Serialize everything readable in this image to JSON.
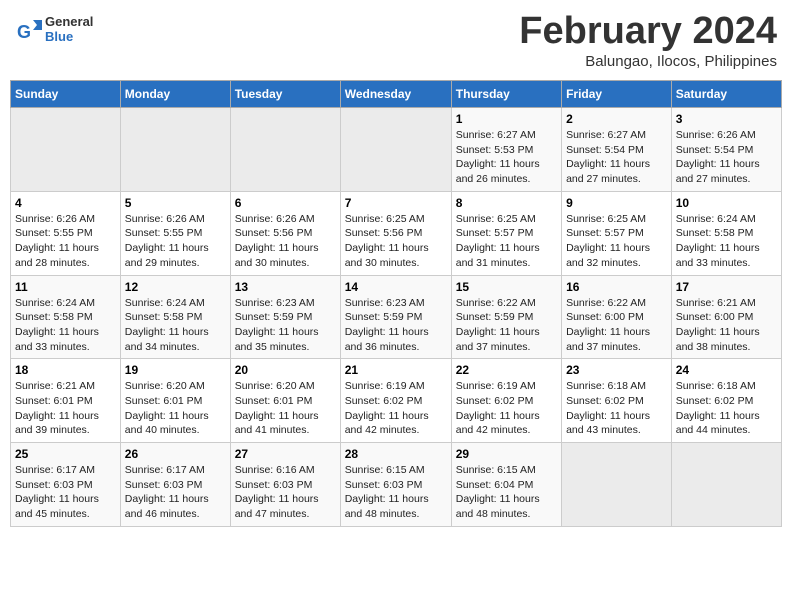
{
  "header": {
    "logo_line1": "General",
    "logo_line2": "Blue",
    "title": "February 2024",
    "subtitle": "Balungao, Ilocos, Philippines"
  },
  "days_of_week": [
    "Sunday",
    "Monday",
    "Tuesday",
    "Wednesday",
    "Thursday",
    "Friday",
    "Saturday"
  ],
  "weeks": [
    [
      {
        "day": "",
        "info": ""
      },
      {
        "day": "",
        "info": ""
      },
      {
        "day": "",
        "info": ""
      },
      {
        "day": "",
        "info": ""
      },
      {
        "day": "1",
        "info": "Sunrise: 6:27 AM\nSunset: 5:53 PM\nDaylight: 11 hours and 26 minutes."
      },
      {
        "day": "2",
        "info": "Sunrise: 6:27 AM\nSunset: 5:54 PM\nDaylight: 11 hours and 27 minutes."
      },
      {
        "day": "3",
        "info": "Sunrise: 6:26 AM\nSunset: 5:54 PM\nDaylight: 11 hours and 27 minutes."
      }
    ],
    [
      {
        "day": "4",
        "info": "Sunrise: 6:26 AM\nSunset: 5:55 PM\nDaylight: 11 hours and 28 minutes."
      },
      {
        "day": "5",
        "info": "Sunrise: 6:26 AM\nSunset: 5:55 PM\nDaylight: 11 hours and 29 minutes."
      },
      {
        "day": "6",
        "info": "Sunrise: 6:26 AM\nSunset: 5:56 PM\nDaylight: 11 hours and 30 minutes."
      },
      {
        "day": "7",
        "info": "Sunrise: 6:25 AM\nSunset: 5:56 PM\nDaylight: 11 hours and 30 minutes."
      },
      {
        "day": "8",
        "info": "Sunrise: 6:25 AM\nSunset: 5:57 PM\nDaylight: 11 hours and 31 minutes."
      },
      {
        "day": "9",
        "info": "Sunrise: 6:25 AM\nSunset: 5:57 PM\nDaylight: 11 hours and 32 minutes."
      },
      {
        "day": "10",
        "info": "Sunrise: 6:24 AM\nSunset: 5:58 PM\nDaylight: 11 hours and 33 minutes."
      }
    ],
    [
      {
        "day": "11",
        "info": "Sunrise: 6:24 AM\nSunset: 5:58 PM\nDaylight: 11 hours and 33 minutes."
      },
      {
        "day": "12",
        "info": "Sunrise: 6:24 AM\nSunset: 5:58 PM\nDaylight: 11 hours and 34 minutes."
      },
      {
        "day": "13",
        "info": "Sunrise: 6:23 AM\nSunset: 5:59 PM\nDaylight: 11 hours and 35 minutes."
      },
      {
        "day": "14",
        "info": "Sunrise: 6:23 AM\nSunset: 5:59 PM\nDaylight: 11 hours and 36 minutes."
      },
      {
        "day": "15",
        "info": "Sunrise: 6:22 AM\nSunset: 5:59 PM\nDaylight: 11 hours and 37 minutes."
      },
      {
        "day": "16",
        "info": "Sunrise: 6:22 AM\nSunset: 6:00 PM\nDaylight: 11 hours and 37 minutes."
      },
      {
        "day": "17",
        "info": "Sunrise: 6:21 AM\nSunset: 6:00 PM\nDaylight: 11 hours and 38 minutes."
      }
    ],
    [
      {
        "day": "18",
        "info": "Sunrise: 6:21 AM\nSunset: 6:01 PM\nDaylight: 11 hours and 39 minutes."
      },
      {
        "day": "19",
        "info": "Sunrise: 6:20 AM\nSunset: 6:01 PM\nDaylight: 11 hours and 40 minutes."
      },
      {
        "day": "20",
        "info": "Sunrise: 6:20 AM\nSunset: 6:01 PM\nDaylight: 11 hours and 41 minutes."
      },
      {
        "day": "21",
        "info": "Sunrise: 6:19 AM\nSunset: 6:02 PM\nDaylight: 11 hours and 42 minutes."
      },
      {
        "day": "22",
        "info": "Sunrise: 6:19 AM\nSunset: 6:02 PM\nDaylight: 11 hours and 42 minutes."
      },
      {
        "day": "23",
        "info": "Sunrise: 6:18 AM\nSunset: 6:02 PM\nDaylight: 11 hours and 43 minutes."
      },
      {
        "day": "24",
        "info": "Sunrise: 6:18 AM\nSunset: 6:02 PM\nDaylight: 11 hours and 44 minutes."
      }
    ],
    [
      {
        "day": "25",
        "info": "Sunrise: 6:17 AM\nSunset: 6:03 PM\nDaylight: 11 hours and 45 minutes."
      },
      {
        "day": "26",
        "info": "Sunrise: 6:17 AM\nSunset: 6:03 PM\nDaylight: 11 hours and 46 minutes."
      },
      {
        "day": "27",
        "info": "Sunrise: 6:16 AM\nSunset: 6:03 PM\nDaylight: 11 hours and 47 minutes."
      },
      {
        "day": "28",
        "info": "Sunrise: 6:15 AM\nSunset: 6:03 PM\nDaylight: 11 hours and 48 minutes."
      },
      {
        "day": "29",
        "info": "Sunrise: 6:15 AM\nSunset: 6:04 PM\nDaylight: 11 hours and 48 minutes."
      },
      {
        "day": "",
        "info": ""
      },
      {
        "day": "",
        "info": ""
      }
    ]
  ]
}
